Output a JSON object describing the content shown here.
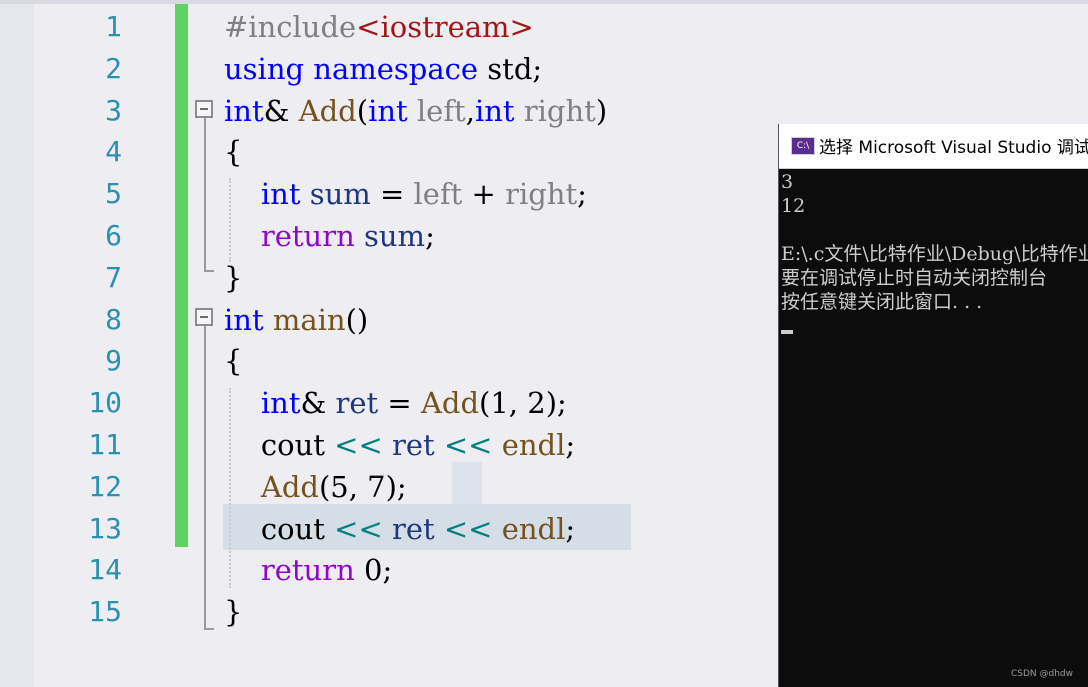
{
  "editor": {
    "lines": [
      {
        "n": "1",
        "tokens": [
          {
            "t": "#include",
            "c": "pp"
          },
          {
            "t": "<iostream>",
            "c": "inc"
          }
        ]
      },
      {
        "n": "2",
        "tokens": [
          {
            "t": "using",
            "c": "k"
          },
          {
            "t": " ",
            "c": ""
          },
          {
            "t": "namespace",
            "c": "k"
          },
          {
            "t": " std;",
            "c": ""
          }
        ]
      },
      {
        "n": "3",
        "tokens": [
          {
            "t": "int",
            "c": "k"
          },
          {
            "t": "& ",
            "c": ""
          },
          {
            "t": "Add",
            "c": "fn"
          },
          {
            "t": "(",
            "c": ""
          },
          {
            "t": "int",
            "c": "k"
          },
          {
            "t": " ",
            "c": ""
          },
          {
            "t": "left",
            "c": "pm"
          },
          {
            "t": ",",
            "c": ""
          },
          {
            "t": "int",
            "c": "k"
          },
          {
            "t": " ",
            "c": ""
          },
          {
            "t": "right",
            "c": "pm"
          },
          {
            "t": ")",
            "c": ""
          }
        ]
      },
      {
        "n": "4",
        "tokens": [
          {
            "t": "{",
            "c": ""
          }
        ]
      },
      {
        "n": "5",
        "tokens": [
          {
            "t": "    ",
            "c": ""
          },
          {
            "t": "int",
            "c": "k"
          },
          {
            "t": " ",
            "c": ""
          },
          {
            "t": "sum",
            "c": "vr"
          },
          {
            "t": " = ",
            "c": ""
          },
          {
            "t": "left",
            "c": "pm"
          },
          {
            "t": " + ",
            "c": ""
          },
          {
            "t": "right",
            "c": "pm"
          },
          {
            "t": ";",
            "c": ""
          }
        ]
      },
      {
        "n": "6",
        "tokens": [
          {
            "t": "    ",
            "c": ""
          },
          {
            "t": "return",
            "c": "kw2"
          },
          {
            "t": " ",
            "c": ""
          },
          {
            "t": "sum",
            "c": "vr"
          },
          {
            "t": ";",
            "c": ""
          }
        ]
      },
      {
        "n": "7",
        "tokens": [
          {
            "t": "}",
            "c": ""
          }
        ]
      },
      {
        "n": "8",
        "tokens": [
          {
            "t": "int",
            "c": "k"
          },
          {
            "t": " ",
            "c": ""
          },
          {
            "t": "main",
            "c": "fn"
          },
          {
            "t": "()",
            "c": ""
          }
        ]
      },
      {
        "n": "9",
        "tokens": [
          {
            "t": "{",
            "c": ""
          }
        ]
      },
      {
        "n": "10",
        "tokens": [
          {
            "t": "    ",
            "c": ""
          },
          {
            "t": "int",
            "c": "k"
          },
          {
            "t": "& ",
            "c": ""
          },
          {
            "t": "ret",
            "c": "vr"
          },
          {
            "t": " = ",
            "c": ""
          },
          {
            "t": "Add",
            "c": "fn"
          },
          {
            "t": "(1, 2);",
            "c": ""
          }
        ]
      },
      {
        "n": "11",
        "tokens": [
          {
            "t": "    ",
            "c": ""
          },
          {
            "t": "cout",
            "c": ""
          },
          {
            "t": " ",
            "c": ""
          },
          {
            "t": "<<",
            "c": "op"
          },
          {
            "t": " ",
            "c": ""
          },
          {
            "t": "ret",
            "c": "vr"
          },
          {
            "t": " ",
            "c": ""
          },
          {
            "t": "<<",
            "c": "op"
          },
          {
            "t": " ",
            "c": ""
          },
          {
            "t": "endl",
            "c": "fn"
          },
          {
            "t": ";",
            "c": ""
          }
        ]
      },
      {
        "n": "12",
        "tokens": [
          {
            "t": "    ",
            "c": ""
          },
          {
            "t": "Add",
            "c": "fn"
          },
          {
            "t": "(5, 7);",
            "c": ""
          }
        ]
      },
      {
        "n": "13",
        "tokens": [
          {
            "t": "    ",
            "c": ""
          },
          {
            "t": "cout",
            "c": ""
          },
          {
            "t": " ",
            "c": ""
          },
          {
            "t": "<<",
            "c": "op"
          },
          {
            "t": " ",
            "c": ""
          },
          {
            "t": "ret",
            "c": "vr"
          },
          {
            "t": " ",
            "c": ""
          },
          {
            "t": "<<",
            "c": "op"
          },
          {
            "t": " ",
            "c": ""
          },
          {
            "t": "endl",
            "c": "fn"
          },
          {
            "t": ";",
            "c": ""
          }
        ]
      },
      {
        "n": "14",
        "tokens": [
          {
            "t": "    ",
            "c": ""
          },
          {
            "t": "return",
            "c": "kw2"
          },
          {
            "t": " 0;",
            "c": ""
          }
        ]
      },
      {
        "n": "15",
        "tokens": [
          {
            "t": "}",
            "c": ""
          }
        ]
      }
    ]
  },
  "console": {
    "icon_label": "C:\\",
    "title": "选择 Microsoft Visual Studio 调试控制台",
    "output": [
      "3",
      "12",
      "",
      "E:\\.c文件\\比特作业\\Debug\\比特作业.exe",
      "要在调试停止时自动关闭控制台",
      "按任意键关闭此窗口. . ."
    ]
  },
  "watermark": "CSDN @dhdw"
}
